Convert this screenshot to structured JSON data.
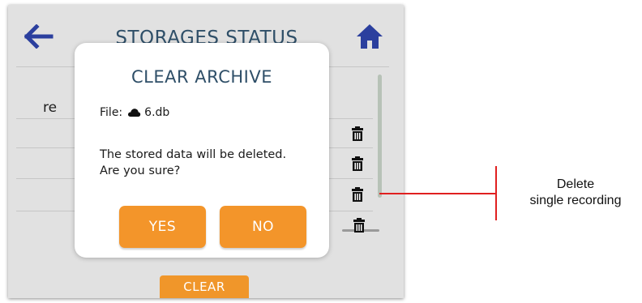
{
  "screen": {
    "title": "STORAGES STATUS",
    "row_label_partial": "re",
    "icons": {
      "back": "arrow-left-icon",
      "home": "home-icon",
      "row_action": "trash-icon",
      "file": "cloud-icon"
    },
    "clear_label": "CLEAR",
    "row_delete_count": 4
  },
  "dialog": {
    "title": "CLEAR ARCHIVE",
    "file_prefix": "File:",
    "file_name": "6.db",
    "message_line1": "The stored data will be deleted.",
    "message_line2": "Are you sure?",
    "yes_label": "YES",
    "no_label": "NO"
  },
  "annotation": {
    "line1": "Delete",
    "line2": "single recording"
  },
  "colors": {
    "accent_orange": "#f3952a",
    "title_text": "#2f4f68",
    "nav_icon": "#2b3f9e",
    "screen_bg": "#e1e1e1",
    "callout_red": "#e02020"
  }
}
